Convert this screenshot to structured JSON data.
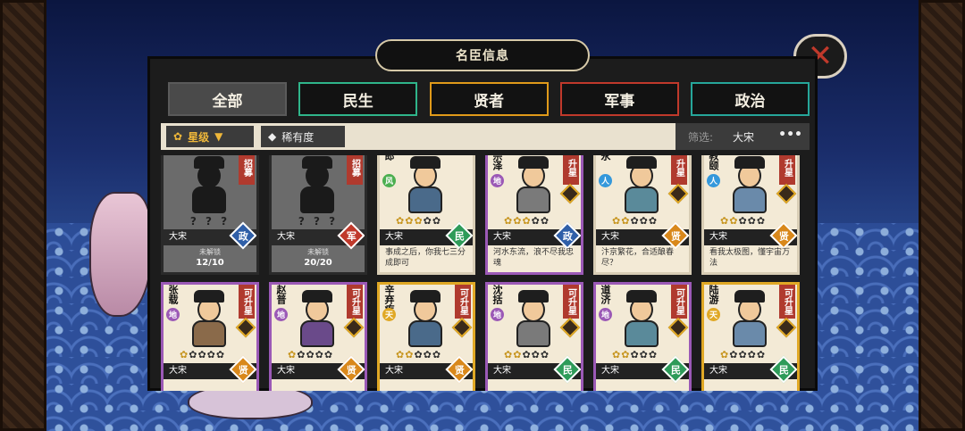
{
  "title": "名臣信息",
  "close_icon": "close-icon",
  "tabs": [
    {
      "label": "全部",
      "active": true
    },
    {
      "label": "民生",
      "active": false
    },
    {
      "label": "贤者",
      "active": false
    },
    {
      "label": "军事",
      "active": false
    },
    {
      "label": "政治",
      "active": false
    }
  ],
  "sort": {
    "star_label": "星级",
    "rarity_label": "稀有度"
  },
  "filter": {
    "label": "筛选:",
    "value": "大宋",
    "more": "•••"
  },
  "cards_row1": [
    {
      "name": "",
      "badge": "招募",
      "locked": true,
      "qmarks": "? ? ?",
      "dynasty": "大宋",
      "type": "政",
      "lock_label": "未解锁",
      "count": "12/10"
    },
    {
      "name": "",
      "badge": "招募",
      "locked": true,
      "qmarks": "? ? ?",
      "dynasty": "大宋",
      "type": "军",
      "lock_label": "未解锁",
      "count": "20/20"
    },
    {
      "name": "郎",
      "element": "风",
      "badge": "",
      "dynasty": "大宋",
      "type": "民",
      "stars": 3,
      "quote": "事成之后，你我七三分成即可"
    },
    {
      "name": "宗泽",
      "element": "地",
      "badge": "升星",
      "dynasty": "大宋",
      "type": "政",
      "stars": 3,
      "quote": "河水东流，浪不尽我忠魂"
    },
    {
      "name": "永",
      "element": "人",
      "badge": "升星",
      "dynasty": "大宋",
      "type": "贤",
      "stars": 2,
      "quote": "汴京繁花，合适酿春尽？"
    },
    {
      "name": "教颐",
      "element": "人",
      "badge": "升星",
      "dynasty": "大宋",
      "type": "贤",
      "stars": 2,
      "quote": "看我太极图，懂宇宙万法"
    }
  ],
  "cards_row2": [
    {
      "name": "张载",
      "element": "地",
      "badge": "可升星",
      "dynasty": "大宋",
      "type": "贤",
      "stars": 1
    },
    {
      "name": "赵普",
      "element": "地",
      "badge": "可升星",
      "dynasty": "大宋",
      "type": "贤",
      "stars": 1
    },
    {
      "name": "辛弃疾",
      "element": "天",
      "badge": "可升星",
      "dynasty": "大宋",
      "type": "贤",
      "stars": 2
    },
    {
      "name": "沈括",
      "element": "地",
      "badge": "可升星",
      "dynasty": "大宋",
      "type": "民",
      "stars": 2
    },
    {
      "name": "道济",
      "element": "地",
      "badge": "可升星",
      "dynasty": "大宋",
      "type": "民",
      "stars": 2
    },
    {
      "name": "陆游",
      "element": "天",
      "badge": "可升星",
      "dynasty": "大宋",
      "type": "民",
      "stars": 1
    }
  ],
  "colors": {
    "type_政": "#2f5fa8",
    "type_军": "#c0392b",
    "type_民": "#2e9b59",
    "type_贤": "#d9881b",
    "elem_风": "#4caf50",
    "elem_地": "#9b59b6",
    "elem_人": "#3498db",
    "elem_天": "#e0a825"
  }
}
